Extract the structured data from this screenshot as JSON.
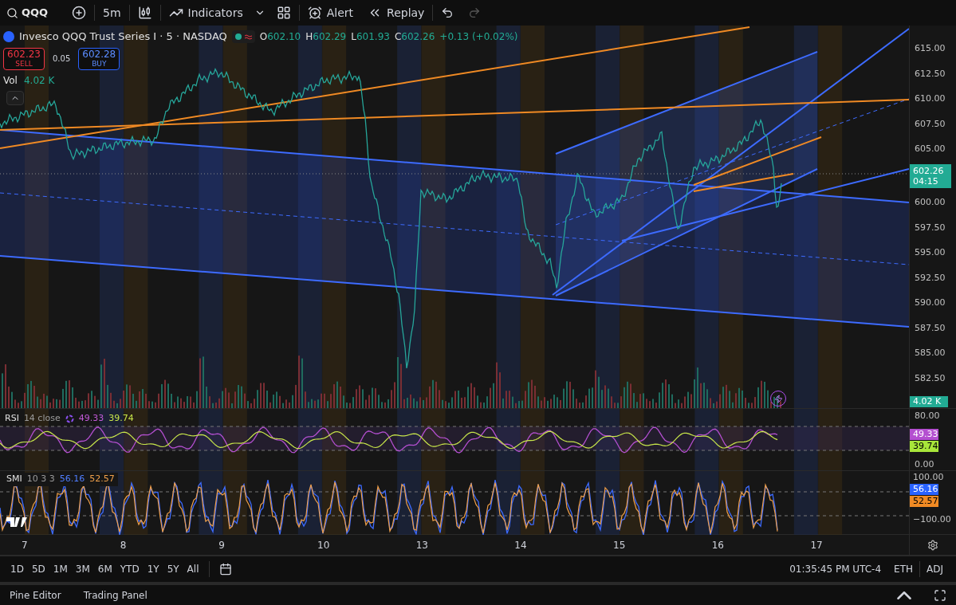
{
  "toolbar": {
    "symbol": "QQQ",
    "interval": "5m",
    "indicators": "Indicators",
    "alert": "Alert",
    "replay": "Replay"
  },
  "legend": {
    "title": "Invesco QQQ Trust Series I · 5 · NASDAQ",
    "ohlc": [
      {
        "label": "O",
        "value": "602.10"
      },
      {
        "label": "H",
        "value": "602.29"
      },
      {
        "label": "L",
        "value": "601.93"
      },
      {
        "label": "C",
        "value": "602.26"
      }
    ],
    "change": "+0.13 (+0.02%)",
    "sell": {
      "price": "602.23",
      "label": "SELL"
    },
    "spread": "0.05",
    "buy": {
      "price": "602.28",
      "label": "BUY"
    },
    "volume": {
      "label": "Vol",
      "value": "4.02 K"
    }
  },
  "price_axis": {
    "labels_upper": [
      "615.00",
      "612.50",
      "610.00",
      "607.50",
      "605.00"
    ],
    "labels_lower": [
      "600.00",
      "597.50",
      "595.00",
      "592.50",
      "590.00",
      "587.50",
      "585.00",
      "582.50"
    ],
    "last_price": "602.26",
    "countdown": "04:15",
    "volume_tag": "4.02 K"
  },
  "rsi": {
    "name": "RSI",
    "params": "14 close",
    "value_1": "49.33",
    "value_2": "39.74",
    "axis": [
      "80.00",
      "0.00"
    ],
    "tag_1": "49.33",
    "tag_2": "39.74"
  },
  "smi": {
    "name": "SMI",
    "params": "10 3 3",
    "value_1": "56.16",
    "value_2": "52.57",
    "axis": [
      "100.00",
      "−100.00"
    ],
    "tag_1": "56.16",
    "tag_2": "52.57"
  },
  "time_axis": [
    "7",
    "8",
    "9",
    "10",
    "13",
    "14",
    "15",
    "16",
    "17"
  ],
  "ranges": [
    "1D",
    "5D",
    "1M",
    "3M",
    "6M",
    "YTD",
    "1Y",
    "5Y",
    "All"
  ],
  "status": {
    "clock": "01:35:45 PM UTC-4",
    "session": "ETH",
    "adjust": "ADJ"
  },
  "bottom_tabs": [
    "Pine Editor",
    "Trading Panel"
  ]
}
